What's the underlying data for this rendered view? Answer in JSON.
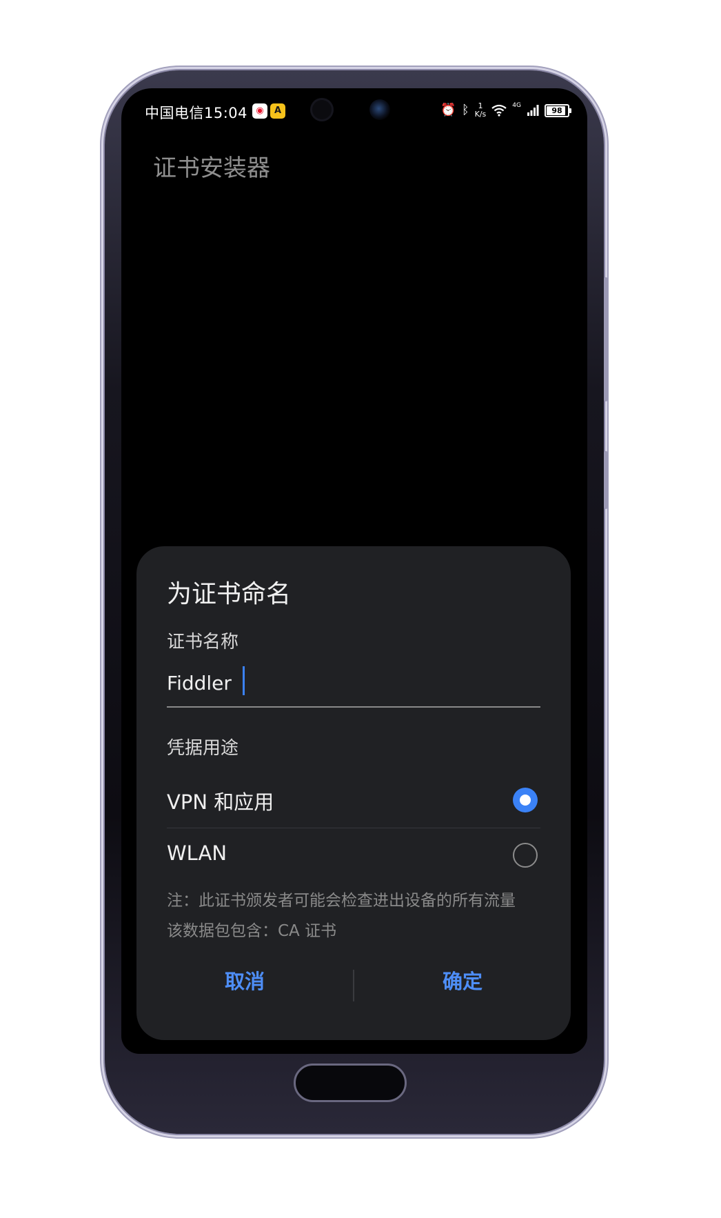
{
  "status_bar": {
    "carrier": "中国电信",
    "time": "15:04",
    "notification_icons": [
      "weibo-icon",
      "a-app-icon"
    ],
    "system_icons": [
      "alarm-icon",
      "bluetooth-icon",
      "wifi-icon",
      "signal-icon"
    ],
    "net_speed_value": "1",
    "net_speed_unit": "K/s",
    "network_type": "4G",
    "battery": "98"
  },
  "app": {
    "title": "证书安装器"
  },
  "dialog": {
    "title": "为证书命名",
    "name_label": "证书名称",
    "name_value": "Fiddler",
    "usage_label": "凭据用途",
    "options": [
      {
        "label": "VPN 和应用",
        "selected": true
      },
      {
        "label": "WLAN",
        "selected": false
      }
    ],
    "note_line1": "注：此证书颁发者可能会检查进出设备的所有流量",
    "note_line2": "该数据包包含：CA 证书",
    "cancel_label": "取消",
    "confirm_label": "确定"
  },
  "colors": {
    "accent": "#3b82f6",
    "dialog_bg": "#202124",
    "screen_bg": "#000000",
    "button_text": "#4e8ef7"
  }
}
